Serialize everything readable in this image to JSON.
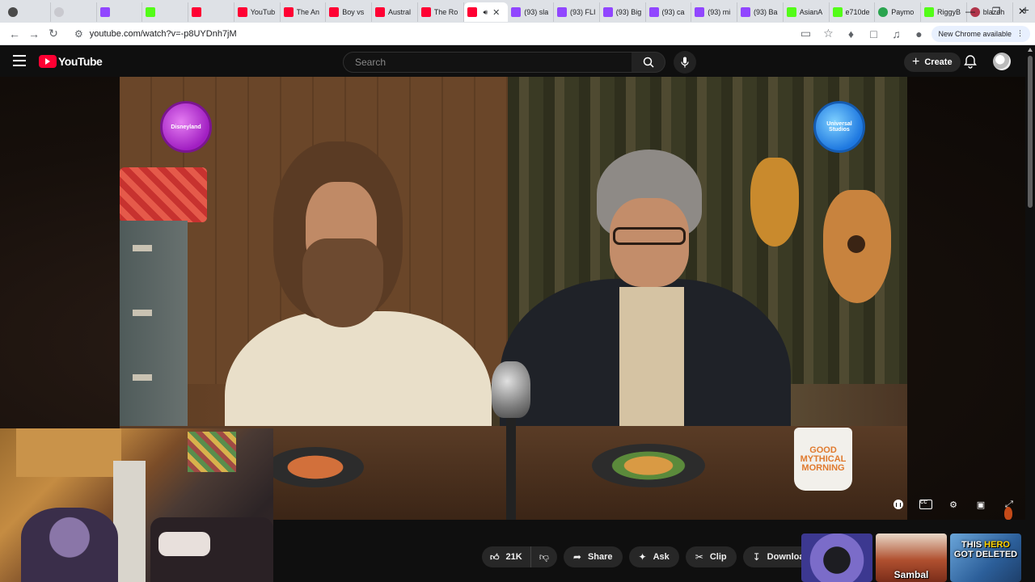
{
  "browser": {
    "tabs": [
      {
        "title": "",
        "favicon": "github-icon",
        "fav_class": "gg"
      },
      {
        "title": "",
        "favicon": "blank-icon",
        "fav_class": "mu"
      },
      {
        "title": "",
        "favicon": "twitch-icon",
        "fav_class": "tw"
      },
      {
        "title": "",
        "favicon": "kick-icon",
        "fav_class": "kk"
      },
      {
        "title": "",
        "favicon": "youtube-icon",
        "fav_class": "yt"
      },
      {
        "title": "YouTub",
        "favicon": "youtube-icon",
        "fav_class": "yt"
      },
      {
        "title": "The An",
        "favicon": "youtube-icon",
        "fav_class": "yt"
      },
      {
        "title": "Boy vs",
        "favicon": "youtube-icon",
        "fav_class": "yt"
      },
      {
        "title": "Austral",
        "favicon": "youtube-icon",
        "fav_class": "yt"
      },
      {
        "title": "The Ro",
        "favicon": "youtube-icon",
        "fav_class": "yt"
      },
      {
        "title": "",
        "favicon": "youtube-icon",
        "fav_class": "yt",
        "active": true
      },
      {
        "title": "(93) sla",
        "favicon": "twitch-icon",
        "fav_class": "tw"
      },
      {
        "title": "(93) FLI",
        "favicon": "twitch-icon",
        "fav_class": "tw"
      },
      {
        "title": "(93) Big",
        "favicon": "twitch-icon",
        "fav_class": "tw"
      },
      {
        "title": "(93) ca",
        "favicon": "twitch-icon",
        "fav_class": "tw"
      },
      {
        "title": "(93) mi",
        "favicon": "twitch-icon",
        "fav_class": "tw"
      },
      {
        "title": "(93) Ba",
        "favicon": "twitch-icon",
        "fav_class": "tw"
      },
      {
        "title": "AsianA",
        "favicon": "kick-icon",
        "fav_class": "kk"
      },
      {
        "title": "e710de",
        "favicon": "kick-icon",
        "fav_class": "kk"
      },
      {
        "title": "Paymo",
        "favicon": "paymo-icon",
        "fav_class": "py"
      },
      {
        "title": "RiggyB",
        "favicon": "kick-icon",
        "fav_class": "kk"
      },
      {
        "title": "blazeh",
        "favicon": "blaze-icon",
        "fav_class": "bl"
      }
    ],
    "new_tab": "+",
    "address": "youtube.com/watch?v=-p8UYDnh7jM",
    "update_label": "New Chrome available"
  },
  "youtube": {
    "logo_text": "YouTube",
    "search_placeholder": "Search",
    "create_label": "Create",
    "video": {
      "mug_brand": "GOOD MYTHICAL MORNING",
      "mug_sub": "",
      "badge_left": "Disneyland",
      "badge_right": "Universal Studios"
    },
    "actions": {
      "like_count": "21K",
      "share": "Share",
      "ask": "Ask",
      "clip": "Clip",
      "download": "Download"
    },
    "recommended": [
      {
        "caption": ""
      },
      {
        "caption": "Sambal"
      },
      {
        "caption_a": "THIS ",
        "caption_b": "HERO",
        "caption_c": "GOT DELETED"
      }
    ]
  }
}
